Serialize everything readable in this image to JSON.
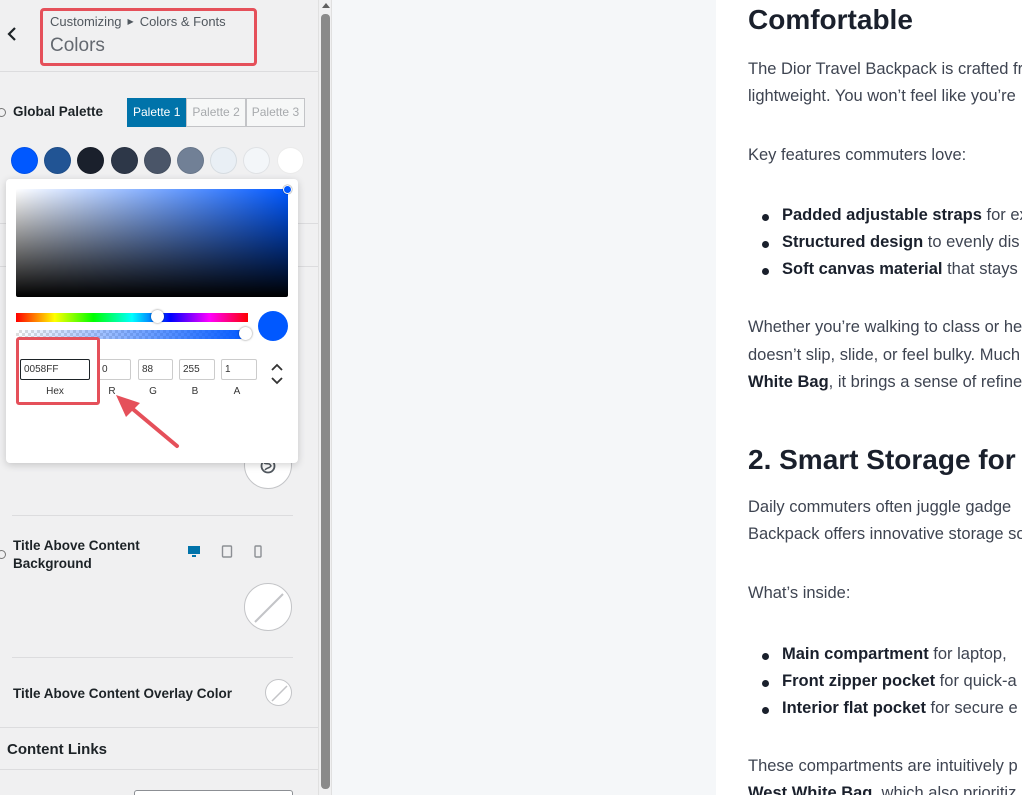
{
  "header": {
    "breadcrumb_root": "Customizing",
    "breadcrumb_parent": "Colors & Fonts",
    "section_title": "Colors"
  },
  "global_palette": {
    "label": "Global Palette",
    "tabs": [
      "Palette 1",
      "Palette 2",
      "Palette 3"
    ],
    "active_tab": "Palette 1",
    "swatches": [
      "#0058ff",
      "#215494",
      "#1a202c",
      "#2d3748",
      "#4a5568",
      "#718096",
      "#e9eff5",
      "#f3f6f9",
      "#ffffff"
    ]
  },
  "picker": {
    "hex_value": "0058FF",
    "r_value": "0",
    "g_value": "88",
    "b_value": "255",
    "a_value": "1",
    "labels": {
      "hex": "Hex",
      "r": "R",
      "g": "G",
      "b": "B",
      "a": "A"
    },
    "current_color": "#0058ff",
    "hue_position": 0.62,
    "alpha": 1
  },
  "settings": {
    "title_bg_label": "Title Above Content Background",
    "overlay_label": "Title Above Content Overlay Color",
    "content_links_label": "Content Links"
  },
  "article": {
    "h_comfortable": "Comfortable",
    "p1_line1": "The Dior Travel Backpack is crafted fr",
    "p1_line2": "lightweight. You won’t feel like you’re",
    "key_features": "Key features commuters love:",
    "bullets1": [
      {
        "bold": "Padded adjustable straps",
        "rest": " for ex"
      },
      {
        "bold": "Structured design",
        "rest": " to evenly dis"
      },
      {
        "bold": "Soft canvas material",
        "rest": " that stays"
      }
    ],
    "p2_line1": "Whether you’re walking to class or he",
    "p2_line2": "doesn’t slip, slide, or feel bulky. Much",
    "p2_line3_bold": "White Bag",
    "p2_line3_rest": ", it brings a sense of refine",
    "h_smart": "2. Smart Storage for",
    "p3_line1": "Daily commuters often juggle gadge",
    "p3_line2": "Backpack offers innovative storage so",
    "whats_inside": "What’s inside:",
    "bullets2": [
      {
        "bold": "Main compartment",
        "rest": " for laptop,"
      },
      {
        "bold": "Front zipper pocket",
        "rest": " for quick-a"
      },
      {
        "bold": "Interior flat pocket",
        "rest": " for secure e"
      }
    ],
    "p4_line1": "These compartments are intuitively p",
    "p4_line2_bold": "West White Bag",
    "p4_line2_rest": ", which also prioritiz"
  }
}
